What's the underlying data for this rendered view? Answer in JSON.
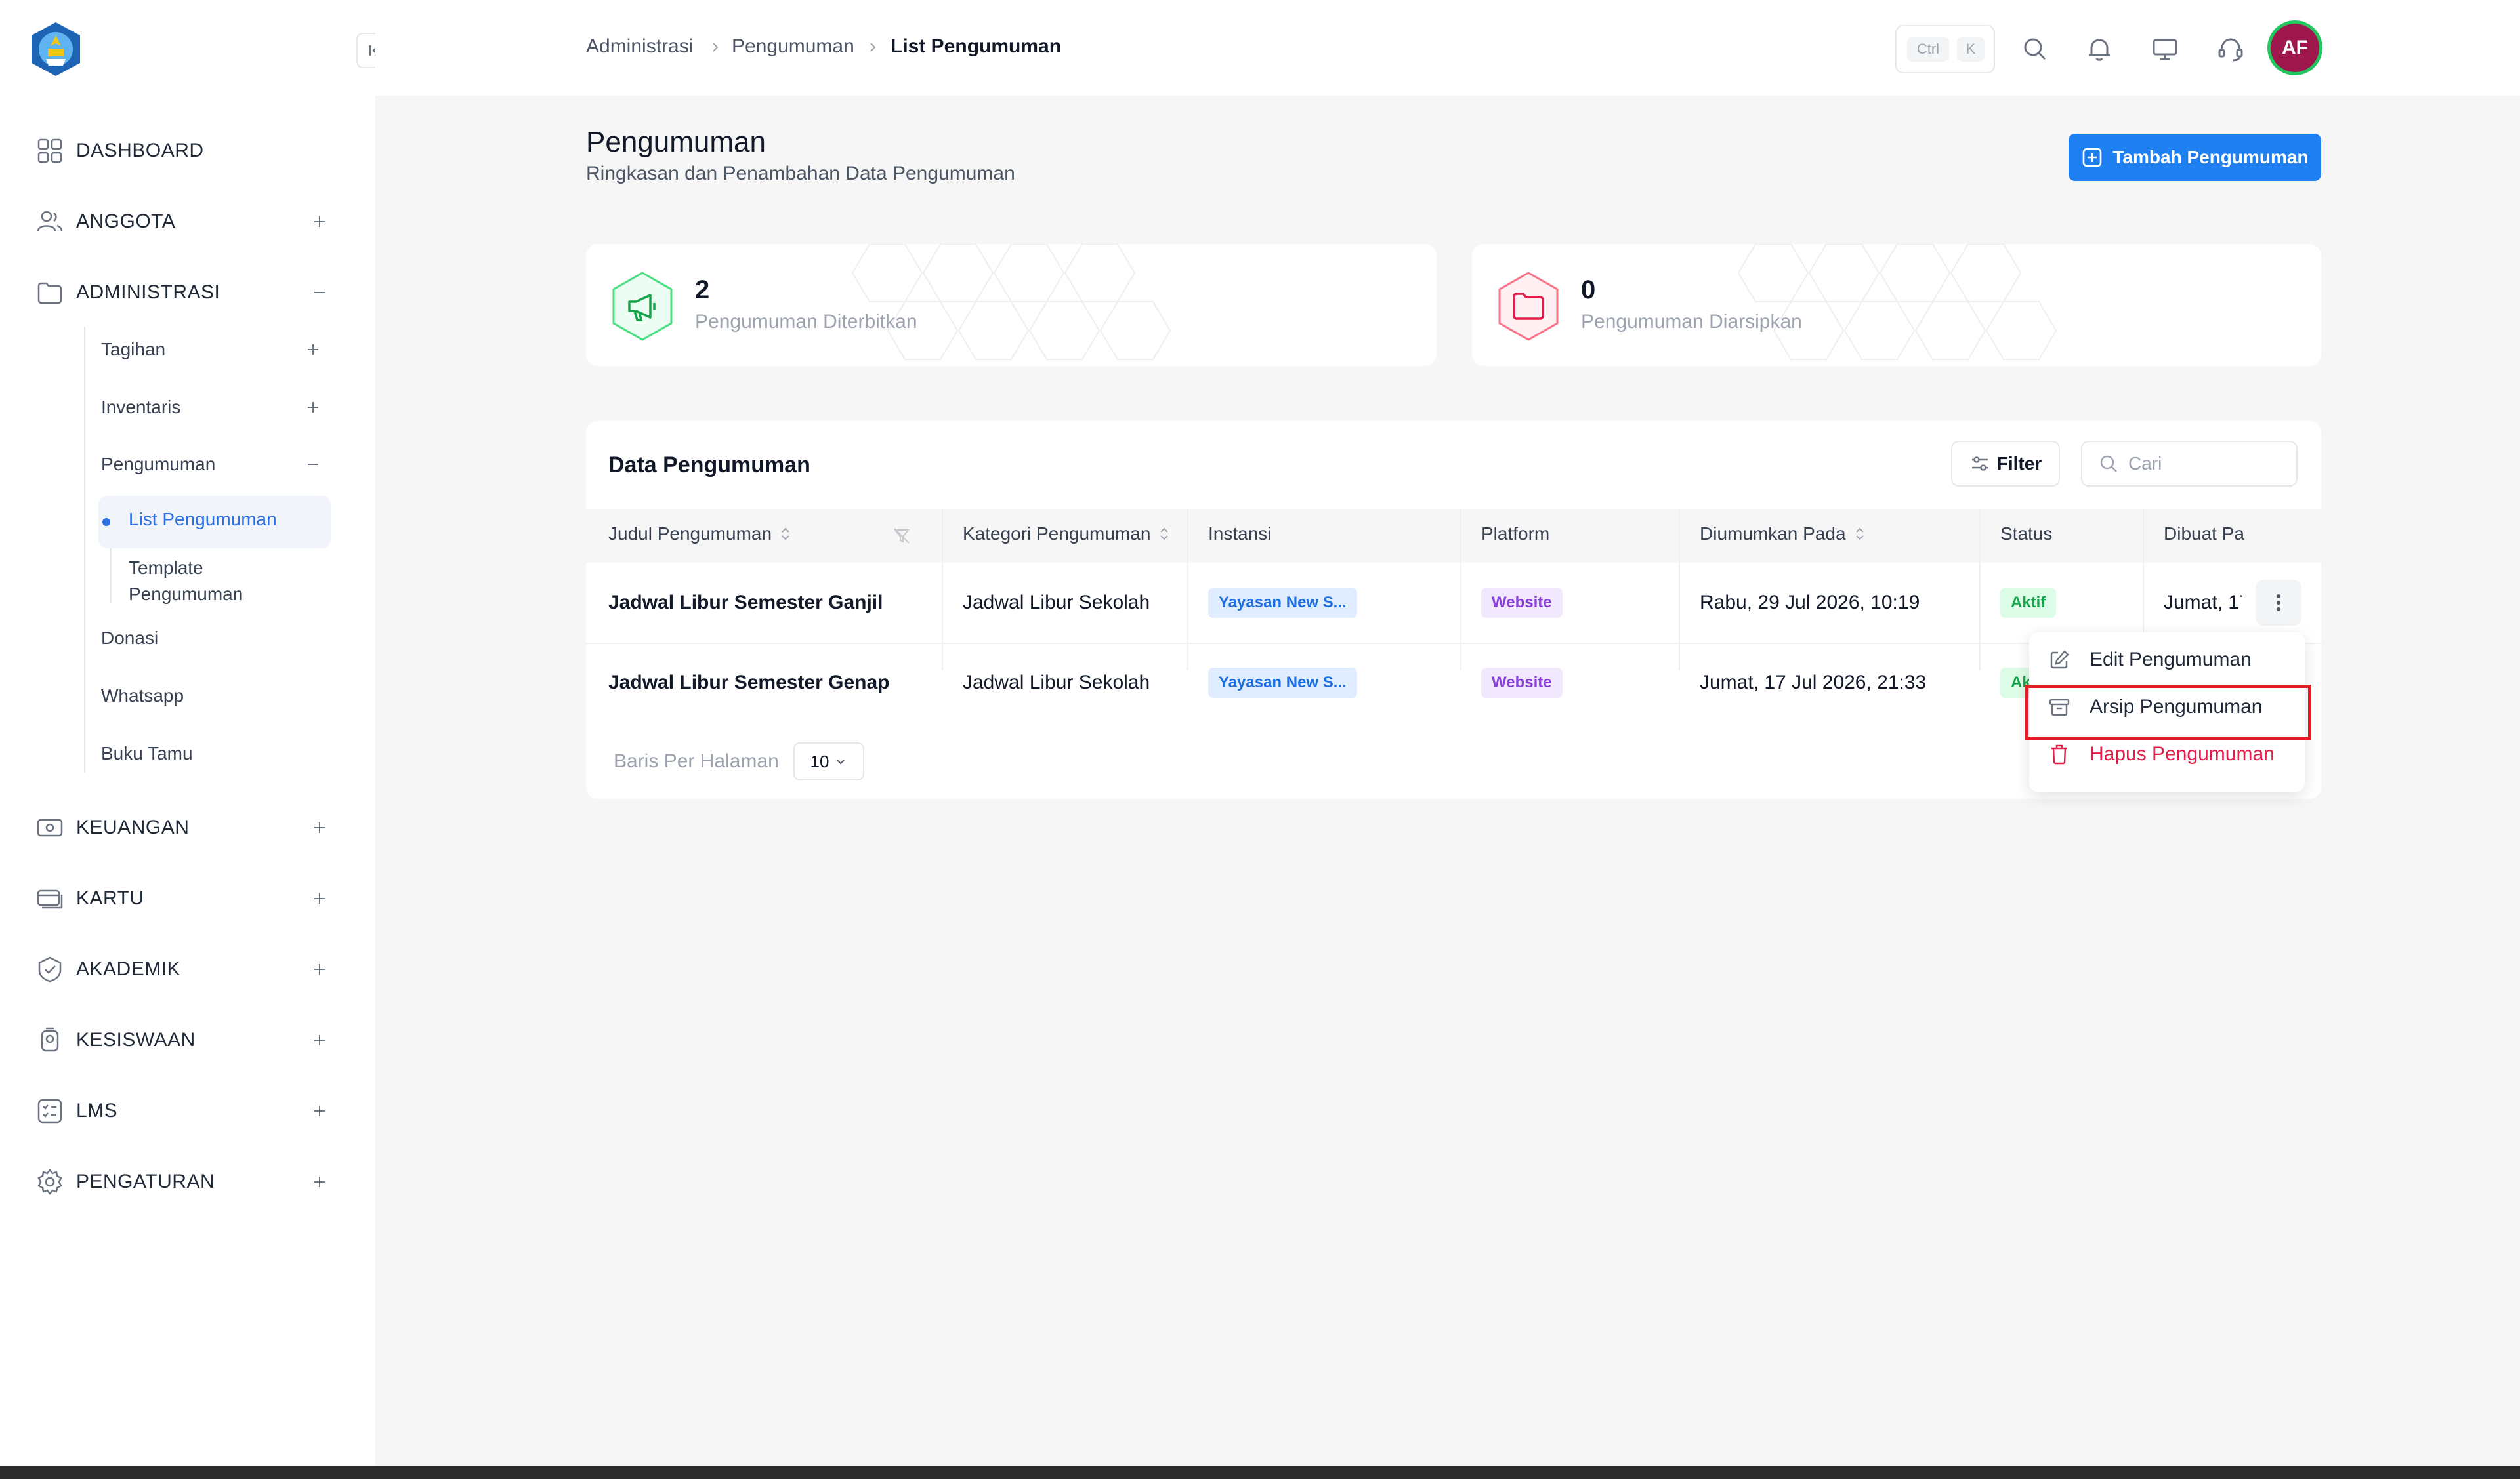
{
  "sidebar": {
    "items": [
      {
        "label": "DASHBOARD"
      },
      {
        "label": "ANGGOTA"
      },
      {
        "label": "ADMINISTRASI"
      },
      {
        "label": "KEUANGAN"
      },
      {
        "label": "KARTU"
      },
      {
        "label": "AKADEMIK"
      },
      {
        "label": "KESISWAAN"
      },
      {
        "label": "LMS"
      },
      {
        "label": "PENGATURAN"
      }
    ],
    "administrasi_children": [
      {
        "label": "Tagihan"
      },
      {
        "label": "Inventaris"
      },
      {
        "label": "Pengumuman"
      },
      {
        "label": "Donasi"
      },
      {
        "label": "Whatsapp"
      },
      {
        "label": "Buku Tamu"
      }
    ],
    "pengumuman_children": [
      {
        "label": "List Pengumuman"
      },
      {
        "label": "Template"
      },
      {
        "label": "Pengumuman"
      }
    ]
  },
  "breadcrumb": [
    "Administrasi",
    "Pengumuman",
    "List Pengumuman"
  ],
  "shortcut": {
    "key1": "Ctrl",
    "key2": "K"
  },
  "user": {
    "initials": "AF"
  },
  "page": {
    "title": "Pengumuman",
    "subtitle": "Ringkasan dan Penambahan Data Pengumuman",
    "add_button": "Tambah Pengumuman"
  },
  "stats": [
    {
      "value": "2",
      "label": "Pengumuman Diterbitkan"
    },
    {
      "value": "0",
      "label": "Pengumuman Diarsipkan"
    }
  ],
  "table": {
    "title": "Data Pengumuman",
    "filter_label": "Filter",
    "search_placeholder": "Cari",
    "columns": [
      "Judul Pengumuman",
      "Kategori Pengumuman",
      "Instansi",
      "Platform",
      "Diumumkan Pada",
      "Status",
      "Dibuat Pa"
    ],
    "rows": [
      {
        "judul": "Jadwal Libur Semester Ganjil",
        "kategori": "Jadwal Libur Sekolah",
        "instansi": "Yayasan New S...",
        "platform": "Website",
        "diumumkan": "Rabu, 29 Jul 2026, 10:19",
        "status": "Aktif",
        "dibuat": "Jumat, 17"
      },
      {
        "judul": "Jadwal Libur Semester Genap",
        "kategori": "Jadwal Libur Sekolah",
        "instansi": "Yayasan New S...",
        "platform": "Website",
        "diumumkan": "Jumat, 17 Jul 2026, 21:33",
        "status": "Ak"
      }
    ],
    "per_page_label": "Baris Per Halaman",
    "per_page_value": "10"
  },
  "context_menu": {
    "edit": "Edit Pengumuman",
    "archive": "Arsip Pengumuman",
    "delete": "Hapus Pengumuman"
  },
  "colors": {
    "primary": "#1e80f0",
    "active_text": "#2f6fe4",
    "success": "#16a34a",
    "danger": "#e11d48",
    "highlight": "#e11d2a"
  }
}
